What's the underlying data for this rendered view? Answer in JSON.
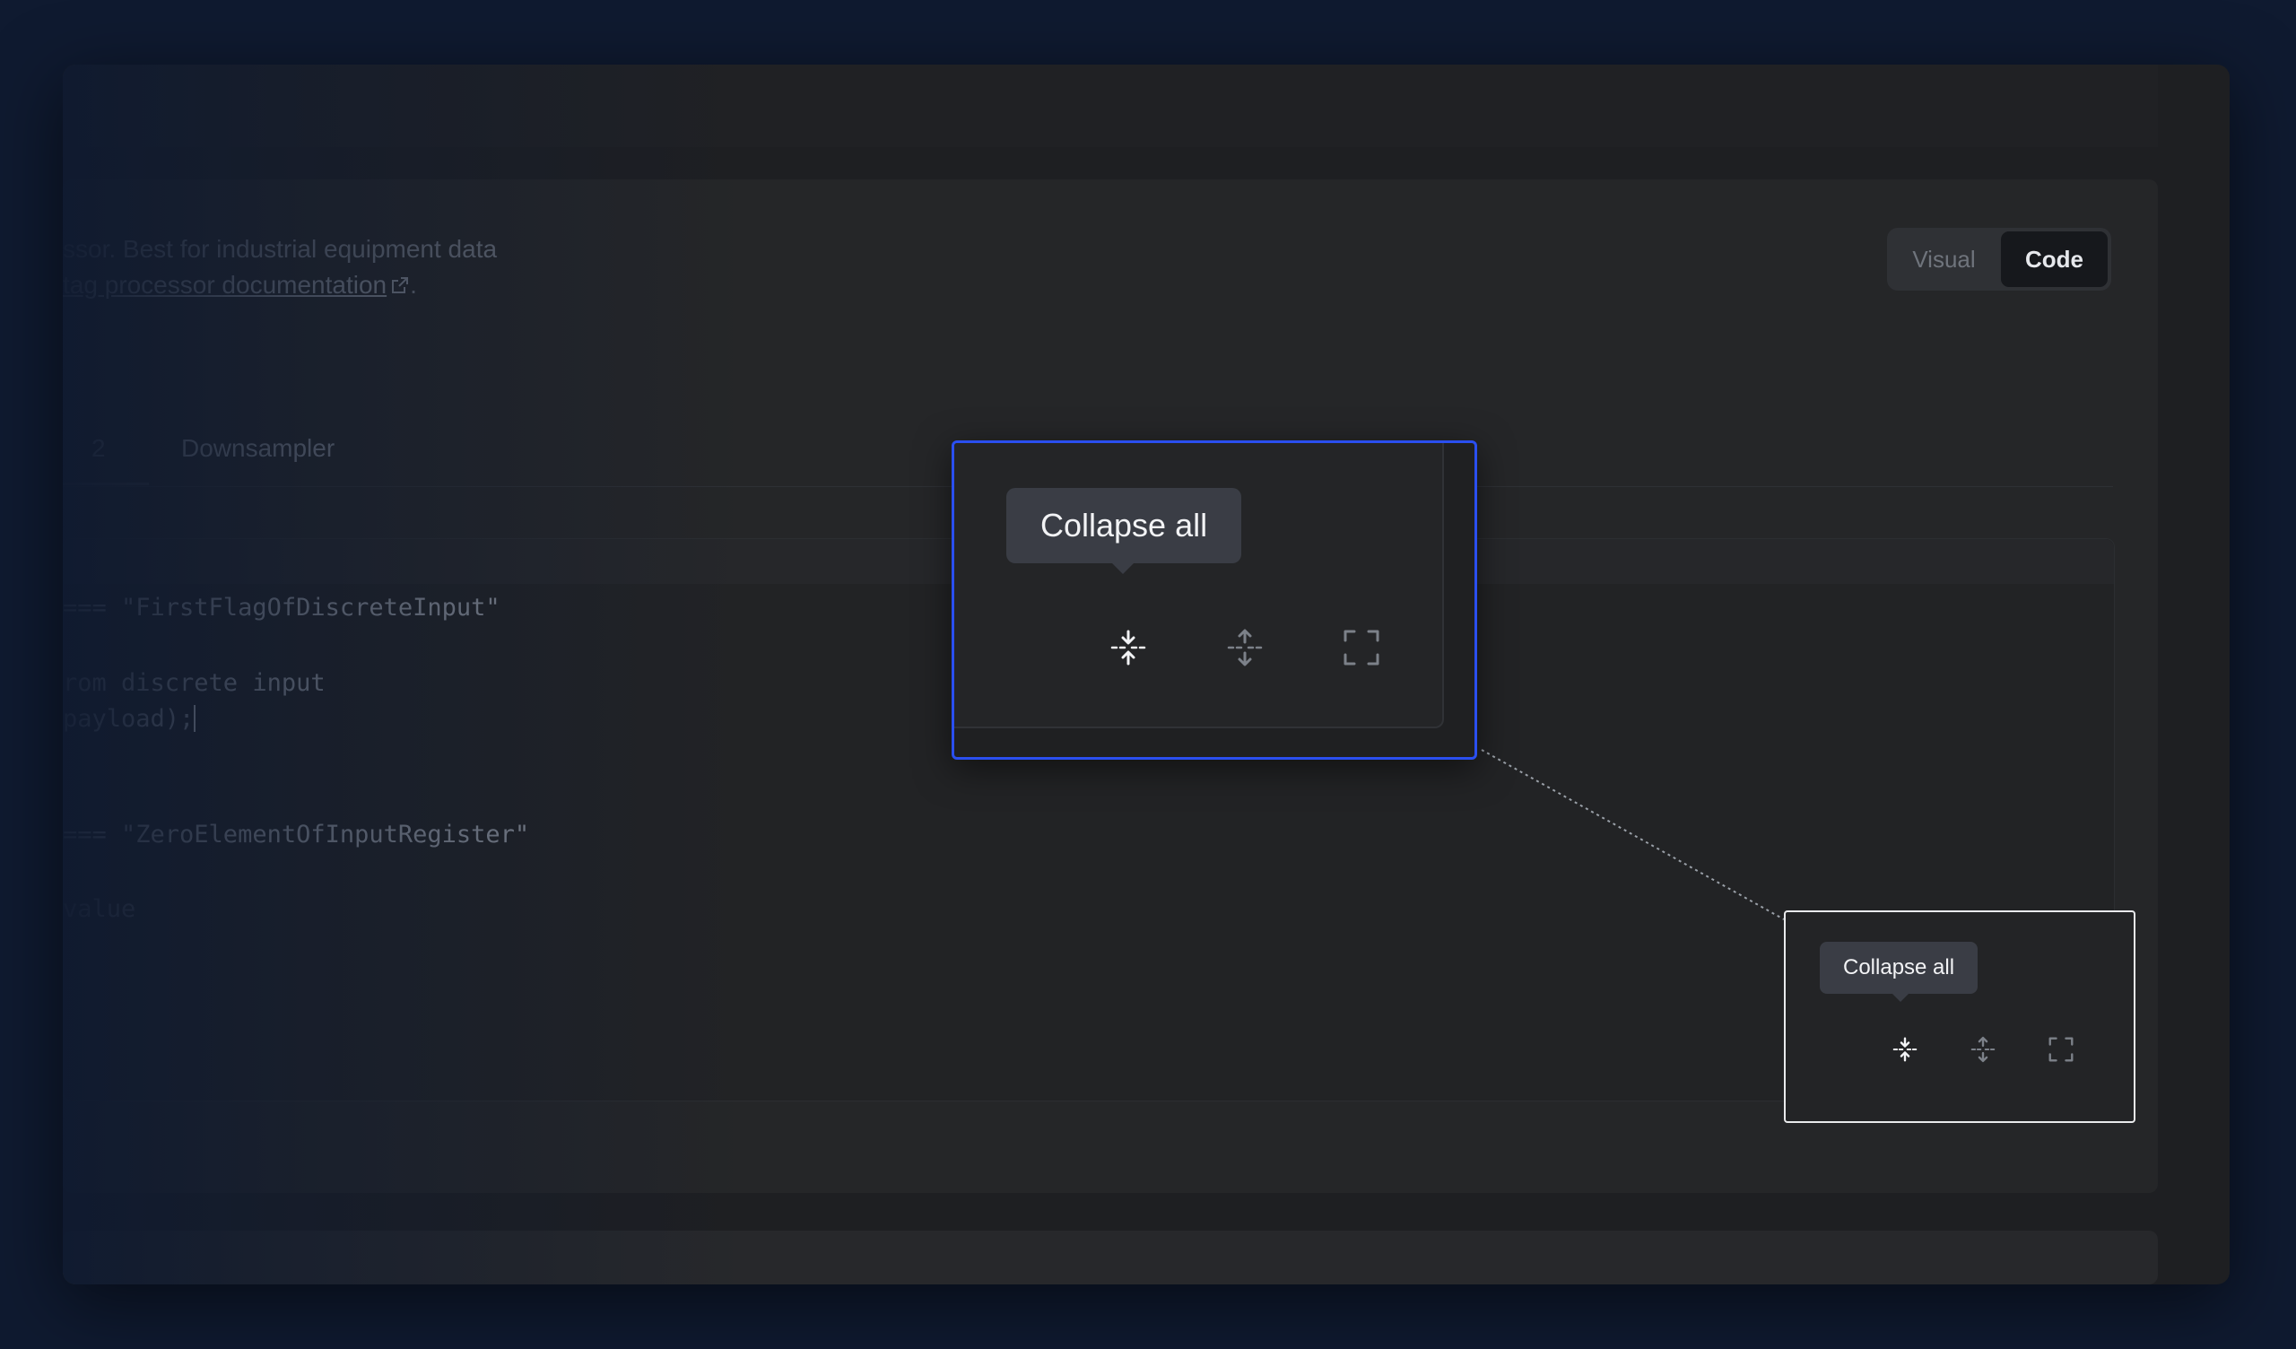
{
  "description": {
    "line1": "ssor. Best for industrial equipment data",
    "line2_prefix": "tag processor ",
    "line2_link": "documentation",
    "line2_suffix": "."
  },
  "view_toggle": {
    "options": [
      "Visual",
      "Code"
    ],
    "selected": "Code"
  },
  "tabs": {
    "partial_tab_label": "2",
    "next_tab_label": "Downsampler"
  },
  "code_lines": [
    "=== \"FirstFlagOfDiscreteInput\"",
    "rom discrete input",
    "payload);",
    "=== \"ZeroElementOfInputRegister\"",
    "value"
  ],
  "toolbar": {
    "tooltip": "Collapse all",
    "icons": [
      "collapse-all-icon",
      "expand-all-icon",
      "fullscreen-icon"
    ]
  },
  "colors": {
    "zoom_border": "#2a4ff0",
    "tooltip_bg": "#3a3d45",
    "background": "#0f1a30"
  }
}
